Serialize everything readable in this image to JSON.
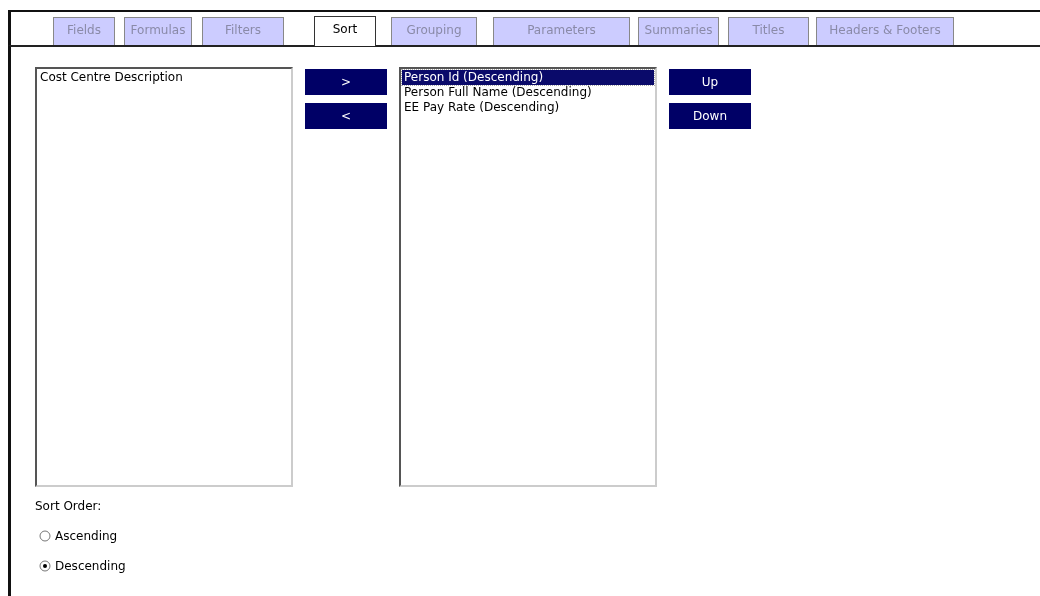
{
  "tabs": [
    {
      "label": "Fields",
      "selected": false
    },
    {
      "label": "Formulas",
      "selected": false
    },
    {
      "label": "Filters",
      "selected": false
    },
    {
      "label": "Sort",
      "selected": true
    },
    {
      "label": "Grouping",
      "selected": false
    },
    {
      "label": "Parameters",
      "selected": false
    },
    {
      "label": "Summaries",
      "selected": false
    },
    {
      "label": "Titles",
      "selected": false
    },
    {
      "label": "Headers & Footers",
      "selected": false
    }
  ],
  "available_list": {
    "items": [
      {
        "label": "Cost Centre Description",
        "selected": false
      }
    ]
  },
  "move_buttons": [
    ">",
    "<"
  ],
  "sort_list": {
    "items": [
      {
        "label": "Person Id (Descending)",
        "selected": true
      },
      {
        "label": "Person Full Name (Descending)",
        "selected": false
      },
      {
        "label": "EE Pay Rate (Descending)",
        "selected": false
      }
    ]
  },
  "order_buttons": [
    "Up",
    "Down"
  ],
  "sort_order": {
    "label": "Sort Order:",
    "options": [
      {
        "label": "Ascending",
        "selected": false
      },
      {
        "label": "Descending",
        "selected": true
      }
    ]
  }
}
